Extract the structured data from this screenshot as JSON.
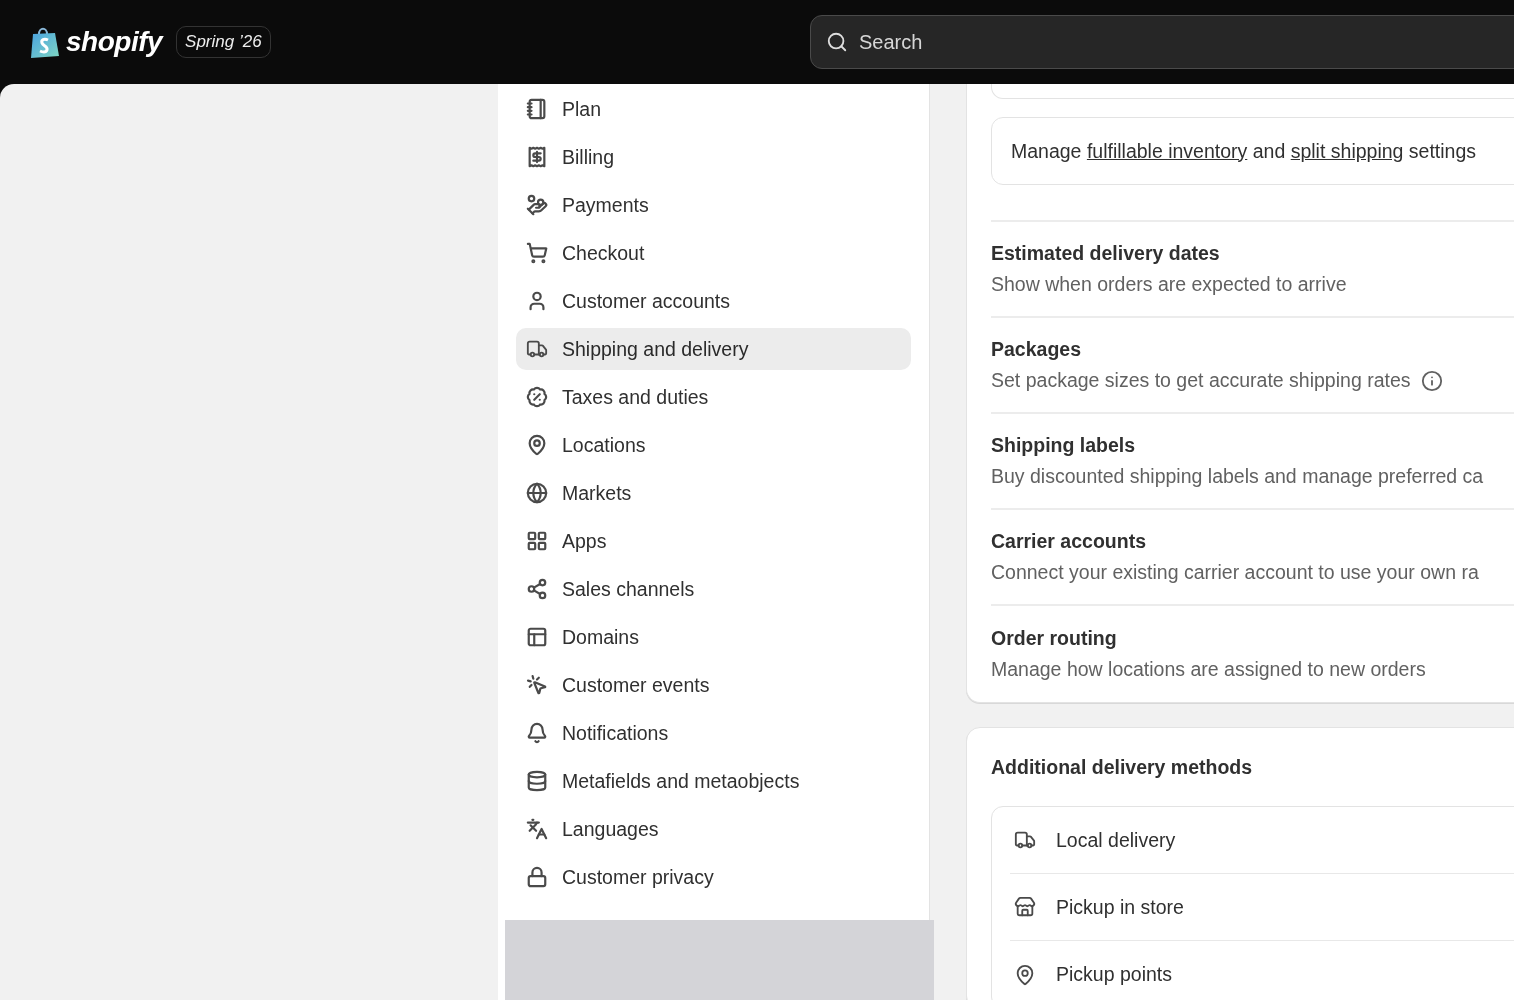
{
  "topbar": {
    "logo": "shopify",
    "badge": "Spring ’26",
    "search": {
      "placeholder": "Search"
    }
  },
  "sidebar": {
    "items": [
      {
        "label": "Plan",
        "selected": false
      },
      {
        "label": "Billing",
        "selected": false
      },
      {
        "label": "Payments",
        "selected": false
      },
      {
        "label": "Checkout",
        "selected": false
      },
      {
        "label": "Customer accounts",
        "selected": false
      },
      {
        "label": "Shipping and delivery",
        "selected": true
      },
      {
        "label": "Taxes and duties",
        "selected": false
      },
      {
        "label": "Locations",
        "selected": false
      },
      {
        "label": "Markets",
        "selected": false
      },
      {
        "label": "Apps",
        "selected": false
      },
      {
        "label": "Sales channels",
        "selected": false
      },
      {
        "label": "Domains",
        "selected": false
      },
      {
        "label": "Customer events",
        "selected": false
      },
      {
        "label": "Notifications",
        "selected": false
      },
      {
        "label": "Metafields and metaobjects",
        "selected": false
      },
      {
        "label": "Languages",
        "selected": false
      },
      {
        "label": "Customer privacy",
        "selected": false
      }
    ]
  },
  "shipping_card": {
    "note": [
      {
        "kind": "text",
        "text": "Manage "
      },
      {
        "kind": "link",
        "text": "fulfillable inventory"
      },
      {
        "kind": "text",
        "text": " and "
      },
      {
        "kind": "link",
        "text": "split shipping"
      },
      {
        "kind": "text",
        "text": " settings"
      }
    ],
    "rows": [
      {
        "title": "Estimated delivery dates",
        "description": "Show when orders are expected to arrive",
        "info": false
      },
      {
        "title": "Packages",
        "description": "Set package sizes to get accurate shipping rates",
        "info": true
      },
      {
        "title": "Shipping labels",
        "description": "Buy discounted shipping labels and manage preferred ca",
        "info": false
      },
      {
        "title": "Carrier accounts",
        "description": "Connect your existing carrier account to use your own ra",
        "info": false
      },
      {
        "title": "Order routing",
        "description": "Manage how locations are assigned to new orders",
        "info": false
      }
    ]
  },
  "delivery_card": {
    "title": "Additional delivery methods",
    "methods": [
      {
        "label": "Local delivery"
      },
      {
        "label": "Pickup in store"
      },
      {
        "label": "Pickup points"
      }
    ]
  }
}
